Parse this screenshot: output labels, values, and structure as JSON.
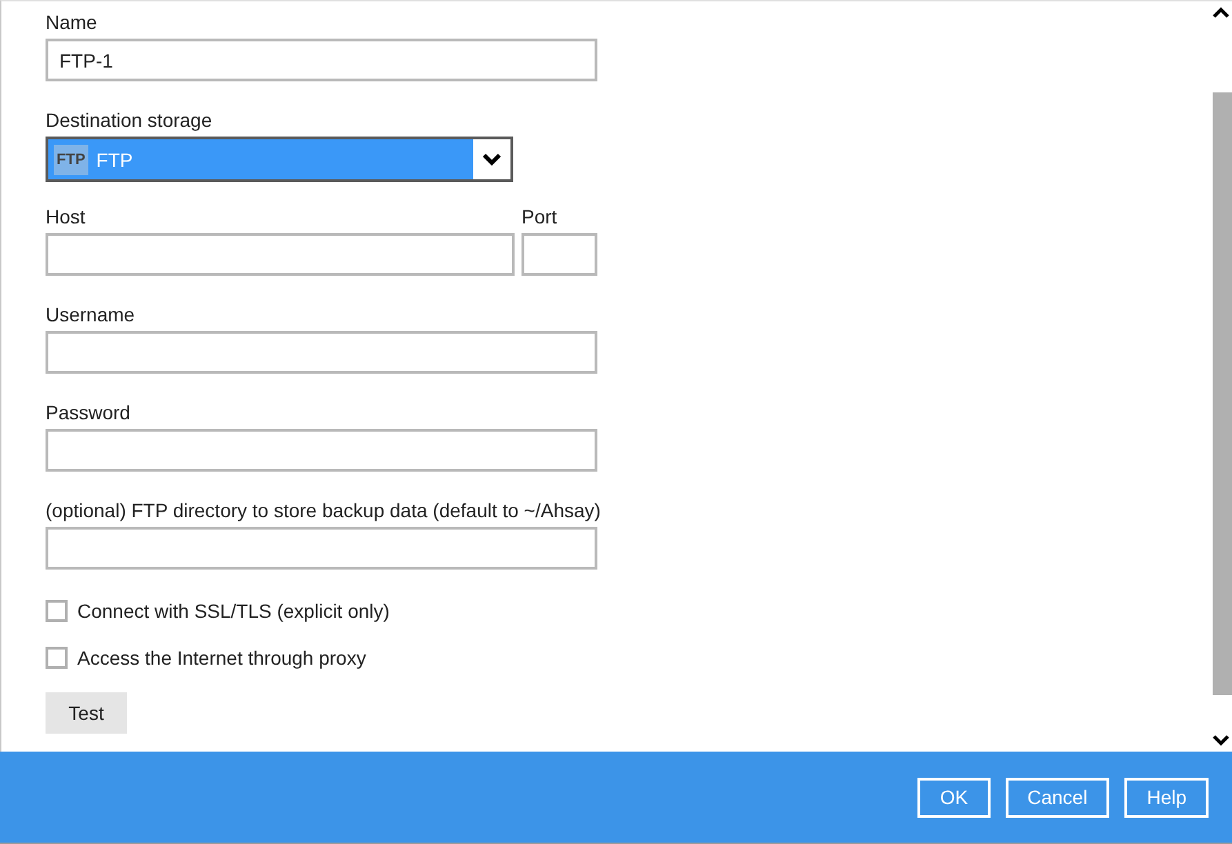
{
  "name_field": {
    "label": "Name",
    "value": "FTP-1"
  },
  "destination_storage": {
    "label": "Destination storage",
    "badge": "FTP",
    "value": "FTP"
  },
  "host_field": {
    "label": "Host"
  },
  "port_field": {
    "label": "Port"
  },
  "username_field": {
    "label": "Username"
  },
  "password_field": {
    "label": "Password"
  },
  "directory_field": {
    "label": "(optional) FTP directory to store backup data (default to ~/Ahsay)"
  },
  "checkboxes": [
    {
      "label": "Connect with SSL/TLS (explicit only)",
      "checked": false
    },
    {
      "label": "Access the Internet through proxy",
      "checked": false
    }
  ],
  "test_button": "Test",
  "footer_buttons": [
    "OK",
    "Cancel",
    "Help"
  ]
}
